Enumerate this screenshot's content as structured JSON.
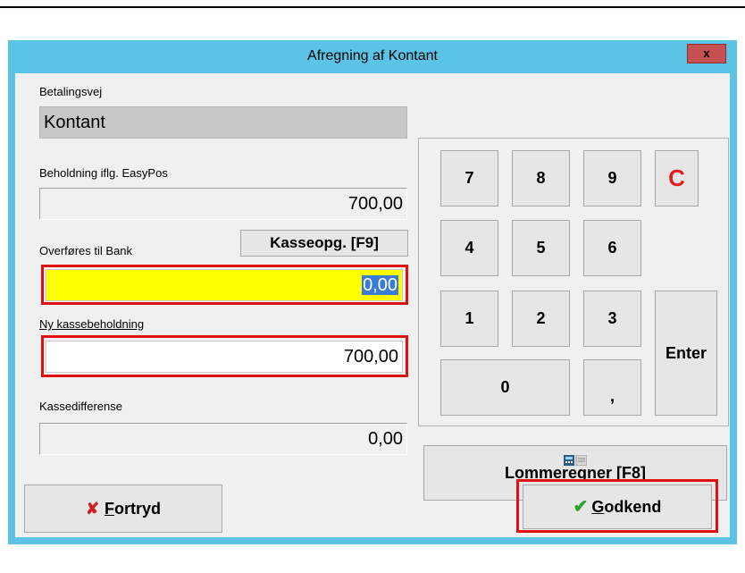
{
  "window": {
    "title": "Afregning af Kontant",
    "close_label": "x"
  },
  "fields": {
    "betalingsvej": {
      "label": "Betalingsvej",
      "value": "Kontant"
    },
    "beholdning": {
      "label": "Beholdning iflg. EasyPos",
      "value": "700,00"
    },
    "overfores": {
      "label": "Overføres til Bank",
      "value": "0,00"
    },
    "ny_kasse": {
      "label": "Ny kassebeholdning",
      "value": "700,00"
    },
    "kassediff": {
      "label": "Kassedifferense",
      "value": "0,00"
    }
  },
  "buttons": {
    "kasseopg": "Kasseopg. [F9]",
    "lommeregner": "Lommeregner [F8]",
    "fortryd_hotkey": "F",
    "fortryd_rest": "ortryd",
    "godkend_hotkey": "G",
    "godkend_rest": "odkend"
  },
  "keypad": {
    "k7": "7",
    "k8": "8",
    "k9": "9",
    "clear": "C",
    "k4": "4",
    "k5": "5",
    "k6": "6",
    "k1": "1",
    "k2": "2",
    "k3": "3",
    "k0": "0",
    "comma": ",",
    "enter": "Enter"
  },
  "icons": {
    "cancel": "x-icon",
    "ok": "check-icon",
    "calc": "calculator-icon"
  },
  "colors": {
    "titlebar": "#5bc4e6",
    "highlight": "#ffff00",
    "annotation": "#e01010",
    "clear_key": "#e02020"
  }
}
